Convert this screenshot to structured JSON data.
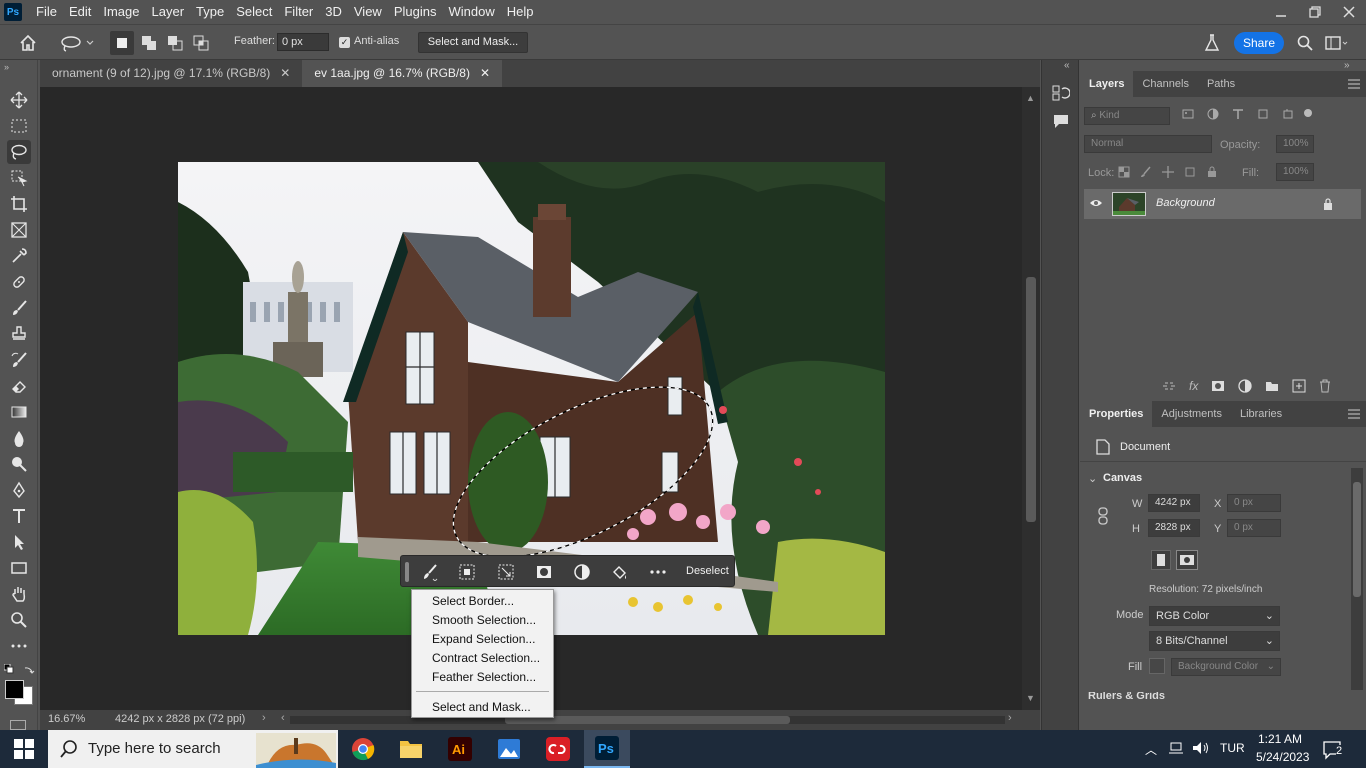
{
  "app": {
    "logo": "Ps"
  },
  "menubar": {
    "items": [
      "File",
      "Edit",
      "Image",
      "Layer",
      "Type",
      "Select",
      "Filter",
      "3D",
      "View",
      "Plugins",
      "Window",
      "Help"
    ]
  },
  "optionsbar": {
    "feather_label": "Feather:",
    "feather_value": "0 px",
    "antialias_label": "Anti-alias",
    "antialias_checked": true,
    "select_mask": "Select and Mask...",
    "share": "Share"
  },
  "tabs": [
    {
      "label": "ornament (9 of 12).jpg @ 17.1% (RGB/8)",
      "active": false
    },
    {
      "label": "ev 1aa.jpg @ 16.7% (RGB/8)",
      "active": true
    }
  ],
  "status": {
    "zoom": "16.67%",
    "docinfo": "4242 px x 2828 px (72 ppi)"
  },
  "layers_panel": {
    "tabs": [
      "Layers",
      "Channels",
      "Paths"
    ],
    "kind_placeholder": "Kind",
    "blend_mode": "Normal",
    "opacity_label": "Opacity:",
    "opacity_value": "100%",
    "lock_label": "Lock:",
    "fill_label": "Fill:",
    "fill_value": "100%",
    "layers": [
      {
        "name": "Background",
        "locked": true,
        "visible": true
      }
    ]
  },
  "properties_panel": {
    "tabs": [
      "Properties",
      "Adjustments",
      "Libraries"
    ],
    "document_label": "Document",
    "canvas_section": "Canvas",
    "w_label": "W",
    "w_value": "4242 px",
    "h_label": "H",
    "h_value": "2828 px",
    "x_label": "X",
    "x_placeholder": "0 px",
    "y_label": "Y",
    "y_placeholder": "0 px",
    "resolution": "Resolution: 72 pixels/inch",
    "mode_label": "Mode",
    "mode_value": "RGB Color",
    "bits_value": "8 Bits/Channel",
    "fill_label": "Fill",
    "fill_value": "Background Color",
    "next_section": "Rulers & Grids"
  },
  "contextbar": {
    "deselect": "Deselect"
  },
  "contextmenu": {
    "items": [
      "Select Border...",
      "Smooth Selection...",
      "Expand Selection...",
      "Contract Selection...",
      "Feather Selection...",
      "Select and Mask..."
    ]
  },
  "taskbar": {
    "search_placeholder": "Type here to search",
    "apps": [
      "chrome-icon",
      "file-explorer-icon",
      "illustrator-icon",
      "photos-icon",
      "creative-cloud-icon",
      "photoshop-icon"
    ],
    "lang": "TUR",
    "time": "1:21 AM",
    "date": "5/24/2023",
    "notifications": "2"
  },
  "colors": {
    "accent": "#1473e6",
    "panel": "#535353",
    "dark": "#424242",
    "canvas_bg": "#282828"
  }
}
